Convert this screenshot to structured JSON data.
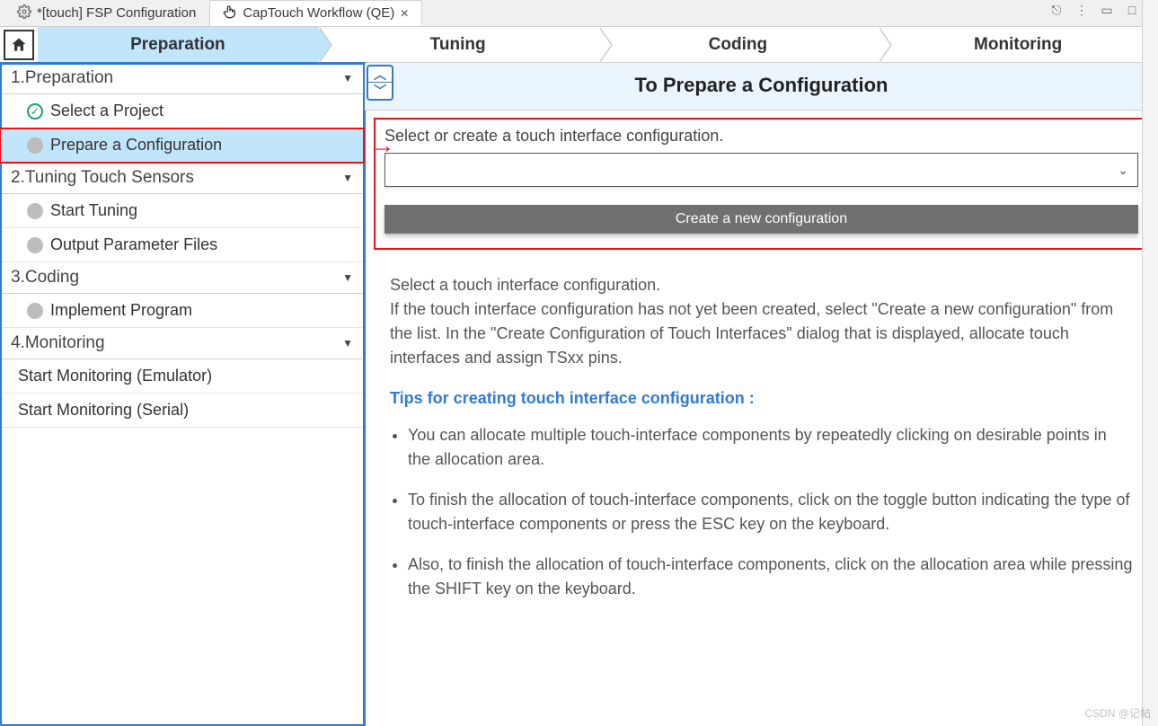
{
  "tabs": {
    "fsp": "*[touch] FSP Configuration",
    "qe": "CapTouch Workflow (QE)"
  },
  "stages": {
    "s1": "Preparation",
    "s2": "Tuning",
    "s3": "Coding",
    "s4": "Monitoring"
  },
  "sidebar": {
    "sec1": "1.Preparation",
    "sec1_items": {
      "a": "Select a Project",
      "b": "Prepare a Configuration"
    },
    "sec2": "2.Tuning Touch Sensors",
    "sec2_items": {
      "a": "Start Tuning",
      "b": "Output Parameter Files"
    },
    "sec3": "3.Coding",
    "sec3_items": {
      "a": "Implement Program"
    },
    "sec4": "4.Monitoring",
    "sec4_items": {
      "a": "Start Monitoring (Emulator)",
      "b": "Start Monitoring (Serial)"
    }
  },
  "content": {
    "title": "To Prepare a Configuration",
    "instr": "Select or create a touch interface configuration.",
    "create_btn": "Create a new configuration",
    "para1": "Select a touch interface configuration.",
    "para2": "If the touch interface configuration has not yet been created, select \"Create a new configuration\" from the list. In the \"Create Configuration of Touch Interfaces\" dialog that is displayed, allocate touch interfaces and assign TSxx pins.",
    "tips_title": "Tips for creating touch interface configuration :",
    "tip1": "You can allocate multiple touch-interface components by repeatedly clicking on desirable points in the allocation area.",
    "tip2": "To finish the allocation of touch-interface components, click on the toggle button indicating the type of touch-interface components or press the ESC key on the keyboard.",
    "tip3": "Also, to finish the allocation of touch-interface components, click on the allocation area while pressing the SHIFT key on the keyboard."
  },
  "watermark": "CSDN @记帖"
}
